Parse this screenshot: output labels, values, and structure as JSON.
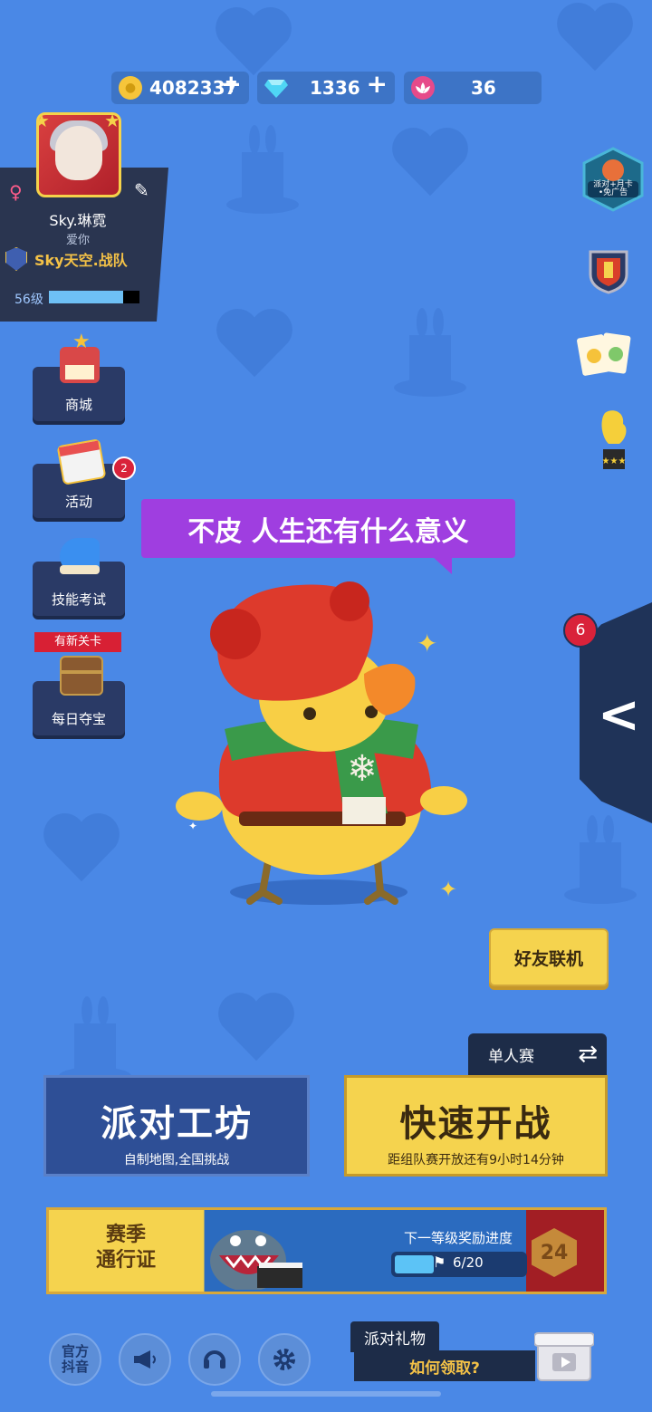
{
  "currency": {
    "coins": "4082337",
    "diamonds": "1336",
    "lotus": "36",
    "plus": "+"
  },
  "profile": {
    "name": "Sky.琳霓",
    "signature": "爱你",
    "team": "Sky天空.战队",
    "level_label": "56级",
    "level_progress": 0.82,
    "gender_symbol": "♀",
    "edit_symbol": "✎"
  },
  "menu": {
    "shop": "商城",
    "activity": "活动",
    "activity_badge": "2",
    "skill_test": "技能考试",
    "new_level_tag": "有新关卡",
    "daily_treasure": "每日夺宝"
  },
  "right": {
    "ad_badge_text": "派对+月卡\n•免广告",
    "side_badge": "6",
    "side_arrow": "<"
  },
  "bubble": {
    "text": "不皮 人生还有什么意义"
  },
  "buttons": {
    "friend_play": "好友联机",
    "mode": "单人赛",
    "workshop_title": "派对工坊",
    "workshop_sub": "自制地图,全国挑战",
    "quick_title": "快速开战",
    "quick_sub": "距组队赛开放还有9小时14分钟"
  },
  "season": {
    "title_line1": "赛季",
    "title_line2": "通行证",
    "next_label": "下一等级奖励进度",
    "progress_text": "6/20",
    "progress": 0.3,
    "level": "24"
  },
  "bottom": {
    "douyin_line1": "官方",
    "douyin_line2": "抖音",
    "gift_title": "派对礼物",
    "gift_link": "如何领取?"
  },
  "colors": {
    "background": "#4a88e6",
    "accent_yellow": "#f5d34e",
    "panel_dark": "#1d2c48",
    "bubble_purple": "#9f3ee0",
    "badge_red": "#d9223a"
  }
}
